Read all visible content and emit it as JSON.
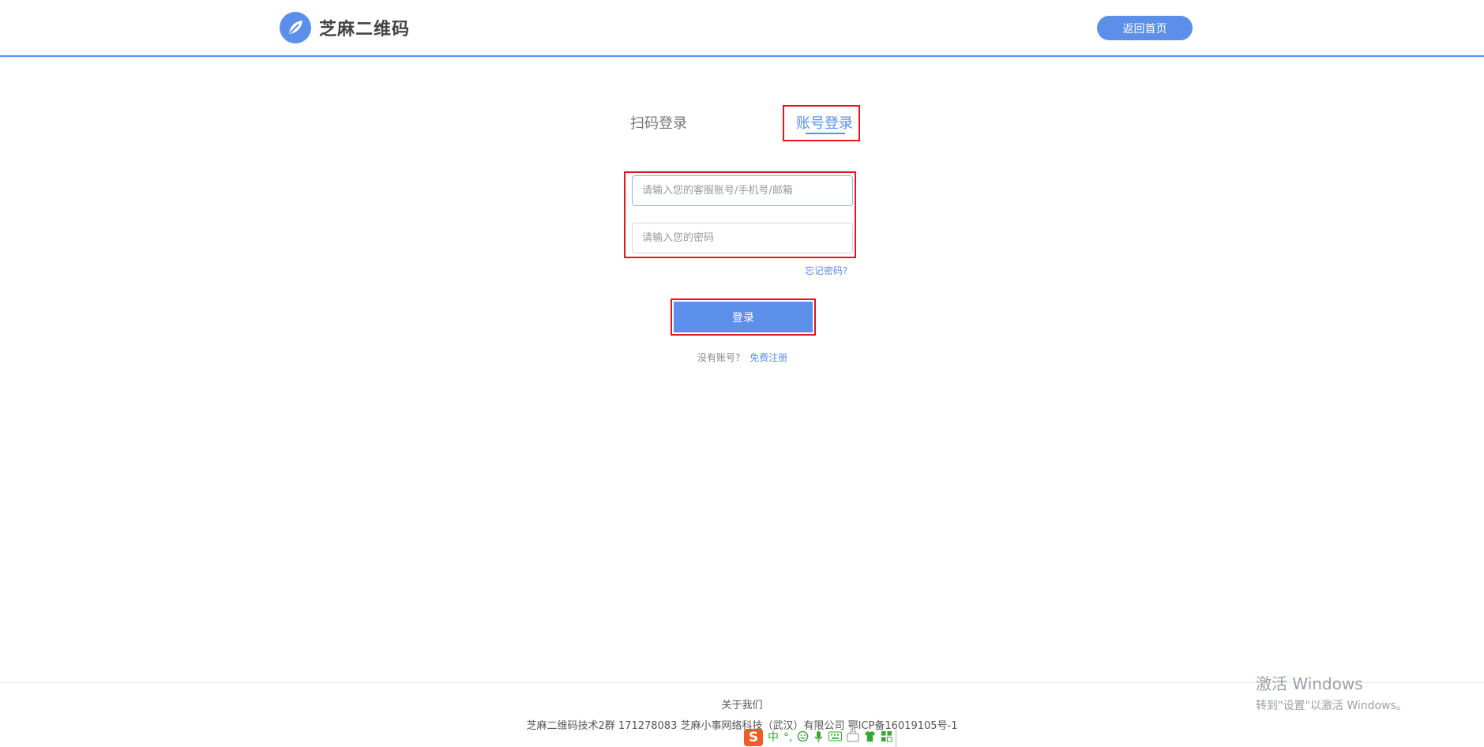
{
  "header": {
    "brand": "芝麻二维码",
    "home_button": "返回首页"
  },
  "tabs": {
    "scan": "扫码登录",
    "account": "账号登录",
    "active": "account"
  },
  "form": {
    "account_placeholder": "请输入您的客服账号/手机号/邮箱",
    "password_placeholder": "请输入您的密码",
    "account_value": "",
    "password_value": "",
    "forgot": "忘记密码?",
    "login_button": "登录",
    "no_account": "没有账号?",
    "register": "免费注册"
  },
  "footer": {
    "about": "关于我们",
    "info": "芝麻二维码技术2群 171278083 芝麻小事网络科技（武汉）有限公司 鄂ICP备16019105号-1"
  },
  "ime_toolbar": {
    "logo": "S",
    "mode": "中",
    "punct": "°,",
    "items": [
      "emoji-icon",
      "microphone-icon",
      "keyboard-icon",
      "toolbox-icon",
      "skin-icon",
      "grid-icon"
    ]
  },
  "watermark": {
    "title": "激活 Windows",
    "subtitle": "转到\"设置\"以激活 Windows。"
  },
  "colors": {
    "accent": "#5b8fea",
    "highlight_box": "#e2161c"
  }
}
